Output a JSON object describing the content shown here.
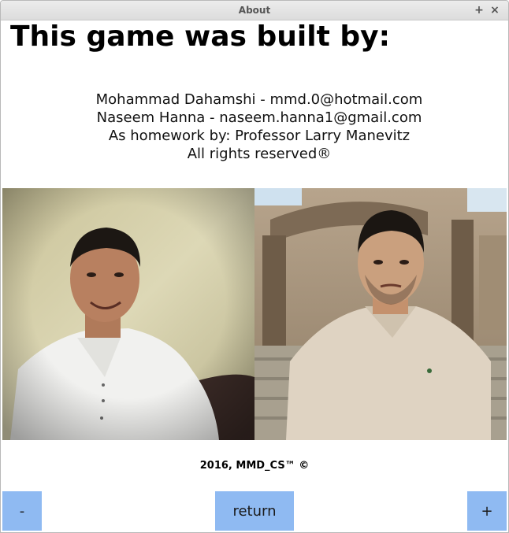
{
  "window": {
    "title": "About",
    "maximize_glyph": "+",
    "close_glyph": "×"
  },
  "heading": "This game was built by:",
  "credits": [
    "Mohammad Dahamshi - mmd.0@hotmail.com",
    "Naseem Hanna - naseem.hanna1@gmail.com",
    "As homework by: Professor Larry Manevitz",
    "All rights reserved®"
  ],
  "footer": "2016, MMD_CS™ ©",
  "buttons": {
    "minus": "-",
    "return": "return",
    "plus": "+"
  },
  "colors": {
    "button_bg": "#8fbaf2"
  }
}
